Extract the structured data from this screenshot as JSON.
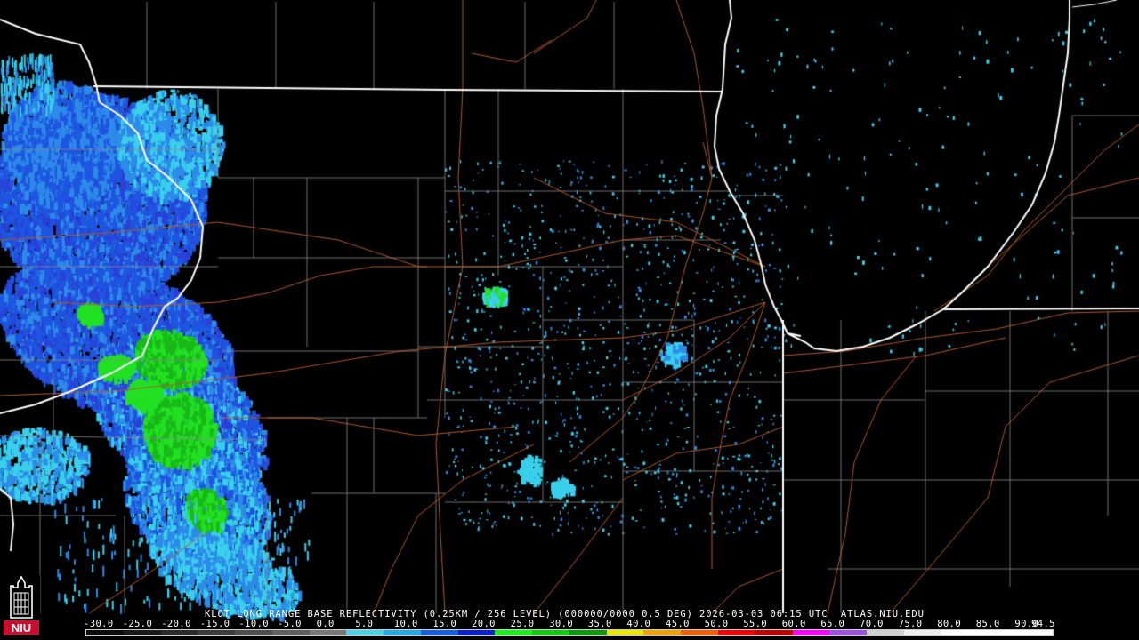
{
  "product": {
    "caption": "KLOT LONG RANGE BASE REFLECTIVITY (0.25KM / 256 LEVEL) (000000/0000 0.5 DEG) 2026-03-03 06:15 UTC  ATLAS.NIU.EDU"
  },
  "colorbar": {
    "tick_labels": [
      "-30.0",
      "-25.0",
      "-20.0",
      "-15.0",
      "-10.0",
      "-5.0",
      "0.0",
      "5.0",
      "10.0",
      "15.0",
      "20.0",
      "25.0",
      "30.0",
      "35.0",
      "40.0",
      "45.0",
      "50.0",
      "55.0",
      "60.0",
      "65.0",
      "70.0",
      "75.0",
      "80.0",
      "85.0",
      "90.0",
      "94.5"
    ],
    "colors": [
      "#0c0c0c",
      "#1a1a1a",
      "#2a2a2a",
      "#3c3c3c",
      "#4e4e4e",
      "#606060",
      "#787878",
      "#4bd2e6",
      "#21a9e8",
      "#1560e0",
      "#0a20d0",
      "#18f018",
      "#0ccc0c",
      "#0a9a0a",
      "#e8e800",
      "#f0a000",
      "#f06000",
      "#f00000",
      "#c00000",
      "#ff00ff",
      "#a050e0",
      "#d0d0d0",
      "#eeeeee",
      "#ffffff",
      "#ffffff",
      "#ffffff"
    ]
  },
  "logo": {
    "text": "NIU",
    "icon": "niu-tower-icon"
  },
  "map": {
    "background": "#000000",
    "state_border_color": "#ffffff",
    "county_line_color": "#8a8a8a",
    "highway_color": "#b05a2a",
    "reflectivity_colors": {
      "light_cyan": "#3ad0ec",
      "light_blue": "#2d8ae8",
      "medium_blue": "#1e55e0",
      "blue": "#2a40d8",
      "green": "#22e022",
      "dark_green": "#18b818"
    }
  }
}
